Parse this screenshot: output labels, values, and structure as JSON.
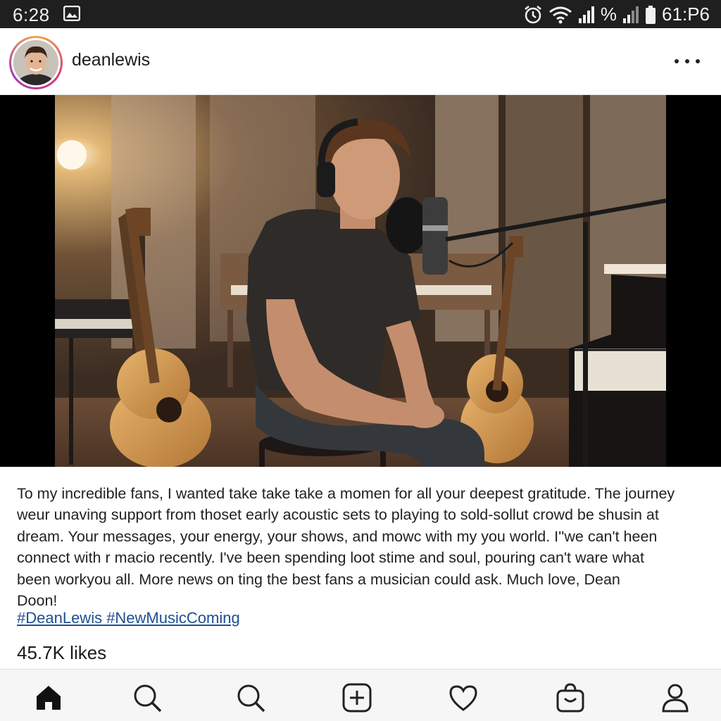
{
  "status_bar": {
    "time": "6:28",
    "battery_text": "61:P6",
    "signal_percent": "%"
  },
  "post": {
    "username": "deanlewis",
    "caption_lines": [
      "To my incredible fans, I wanted take take take a momen for all your deepest gratitude. The journey",
      "weur unaving support from thoset early acoustic sets to playing to sold-sollut crowd be shusin at",
      "dream. Your messages, your energy, your shows, and mowc with my you world. I''we can't heen",
      "connect with r macio recently. I've been spending loot stime and soul, pouring can't ware what",
      "been workyou all. More news on ting the best fans a musician could ask. Much love, Dean",
      "Doon!"
    ],
    "hashtags": "#DeanLewis #NewMusicComing",
    "likes": "45.7K likes"
  },
  "nav": {
    "items": [
      "home-icon",
      "search-icon",
      "explore-search-icon",
      "add-post-icon",
      "activity-heart-icon",
      "shopping-bag-icon",
      "profile-icon"
    ]
  },
  "colors": {
    "status_bar_bg": "#1f1f1f",
    "hashtag": "#1d4f91",
    "avatar_ring": "#d83b7a"
  }
}
